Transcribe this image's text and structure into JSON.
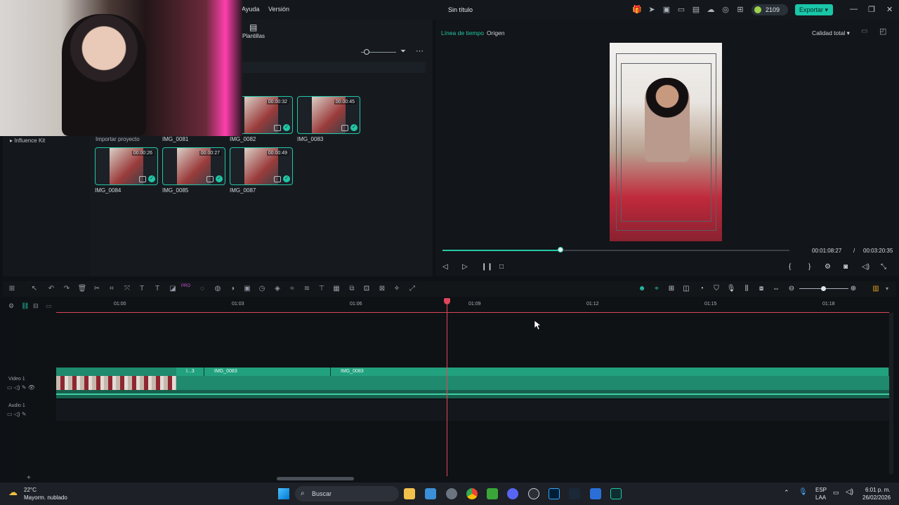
{
  "titlebar": {
    "menu": [
      "Ayuda",
      "Versión"
    ],
    "title": "Sin título",
    "credits": "2109",
    "export_label": "Exportar"
  },
  "media": {
    "tab_label": "Plantillas",
    "sidebar_item": "Influence Kit",
    "import_label": "Importar proyecto",
    "clips": [
      {
        "name": "IMG_0081",
        "duration": ""
      },
      {
        "name": "IMG_0082",
        "duration": "00:00:32"
      },
      {
        "name": "IMG_0083",
        "duration": "00:00:45"
      },
      {
        "name": "IMG_0084",
        "duration": "00:00:26"
      },
      {
        "name": "IMG_0085",
        "duration": "00:00:27"
      },
      {
        "name": "IMG_0087",
        "duration": "00:00:49"
      }
    ]
  },
  "preview": {
    "tab_timeline": "Línea de tiempo",
    "tab_source": "Origen",
    "quality": "Calidad total",
    "current_time": "00:01:08:27",
    "separator": "/",
    "total_time": "00:03:20:35",
    "progress_fraction": 0.34
  },
  "timeline": {
    "ruler": [
      "01:00",
      "01:03",
      "01:06",
      "01:09",
      "01:12",
      "01:15",
      "01:18"
    ],
    "video_track": "Video 1",
    "audio_track": "Audio 1",
    "clip_labels": [
      "I...3",
      "IMG_0083",
      "IMG_0083"
    ],
    "ai_badge": "PRO"
  },
  "taskbar": {
    "temperature": "22°C",
    "weather": "Mayorm. nublado",
    "search": "Buscar",
    "language": "ESP",
    "language_sub": "LAA",
    "clock_time": "6:01 p. m.",
    "clock_date": "26/02/2026"
  }
}
